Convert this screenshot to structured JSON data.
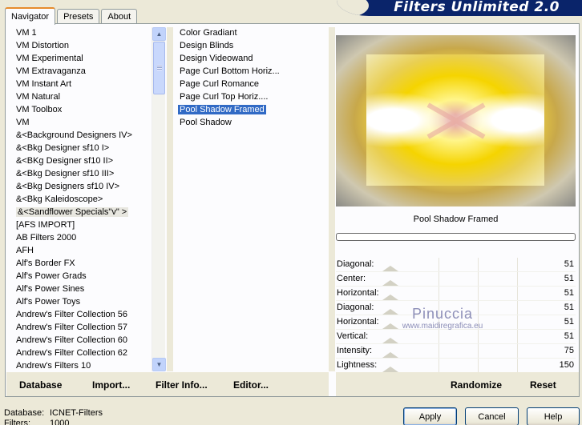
{
  "header": {
    "title": "Filters Unlimited 2.0"
  },
  "tabs": [
    {
      "label": "Navigator",
      "active": true
    },
    {
      "label": "Presets",
      "active": false
    },
    {
      "label": "About",
      "active": false
    }
  ],
  "categories": {
    "items": [
      "VM 1",
      "VM Distortion",
      "VM Experimental",
      "VM Extravaganza",
      "VM Instant Art",
      "VM Natural",
      "VM Toolbox",
      "VM",
      "&<Background Designers IV>",
      "&<Bkg Designer sf10 I>",
      "&<BKg Designer sf10 II>",
      "&<Bkg Designer sf10 III>",
      "&<Bkg Designers sf10 IV>",
      "&<Bkg Kaleidoscope>",
      "&<Sandflower Specials\"v\" >",
      "[AFS IMPORT]",
      "AB Filters 2000",
      "AFH",
      "Alf's Border FX",
      "Alf's Power Grads",
      "Alf's Power Sines",
      "Alf's Power Toys",
      "Andrew's Filter Collection 56",
      "Andrew's Filter Collection 57",
      "Andrew's Filter Collection 60",
      "Andrew's Filter Collection 62",
      "Andrew's Filters 10"
    ],
    "selected_index": 14
  },
  "filters": {
    "items": [
      "Color Gradiant",
      "Design Blinds",
      "Design Videowand",
      "Page Curl Bottom Horiz...",
      "Page Curl Romance",
      "Page Curl Top Horiz....",
      "Pool Shadow Framed",
      "Pool Shadow"
    ],
    "selected_index": 6
  },
  "preview": {
    "effect_name": "Pool Shadow Framed"
  },
  "watermark": {
    "line1": "Pinuccia",
    "line2": "www.maidiregrafica.eu"
  },
  "params": [
    {
      "label": "Diagonal:",
      "value": "51"
    },
    {
      "label": "Center:",
      "value": "51"
    },
    {
      "label": "Horizontal:",
      "value": "51"
    },
    {
      "label": "Diagonal:",
      "value": "51"
    },
    {
      "label": "Horizontal:",
      "value": "51"
    },
    {
      "label": "Vertical:",
      "value": "51"
    },
    {
      "label": "Intensity:",
      "value": "75"
    },
    {
      "label": "Lightness:",
      "value": "150"
    }
  ],
  "toolbar": {
    "database": "Database",
    "import": "Import...",
    "filter_info": "Filter Info...",
    "editor": "Editor...",
    "randomize": "Randomize",
    "reset": "Reset"
  },
  "status": {
    "database_label": "Database:",
    "database_value": "ICNET-Filters",
    "filters_label": "Filters:",
    "filters_value": "1000"
  },
  "buttons": {
    "apply": "Apply",
    "cancel": "Cancel",
    "help": "Help"
  }
}
